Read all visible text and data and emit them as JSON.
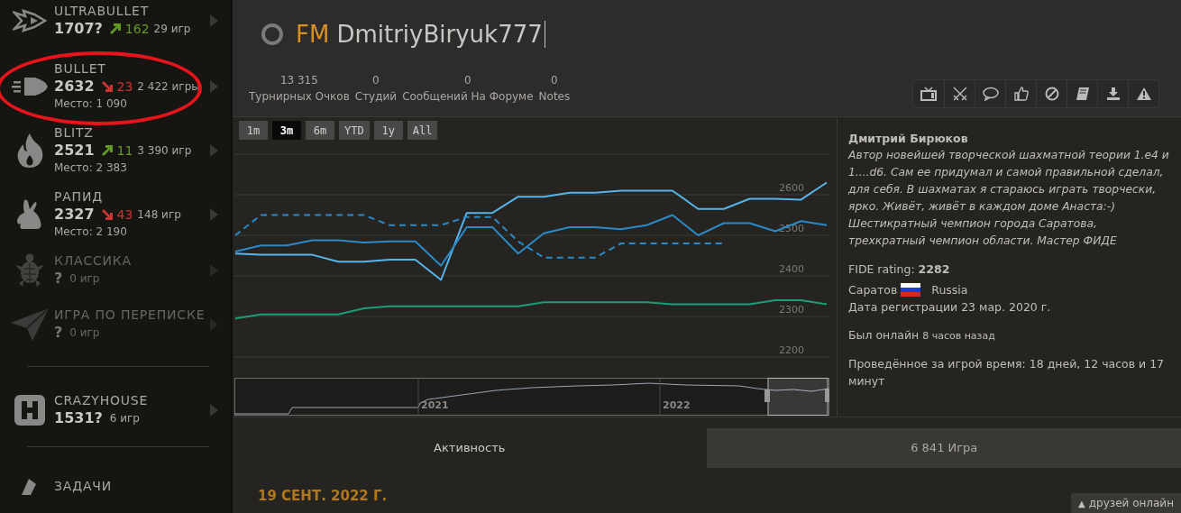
{
  "sidebar": {
    "items": [
      {
        "kind": "variant",
        "name": "ULTRABULLET",
        "rating": "1707?",
        "rising": true,
        "diff": "162",
        "games": "29 игр",
        "dim": false,
        "circled": false
      },
      {
        "kind": "variant",
        "name": "BULLET",
        "rating": "2632",
        "rising": false,
        "diff": "23",
        "games": "2 422 игры",
        "rank": "Место: 1 090",
        "dim": false,
        "circled": true
      },
      {
        "kind": "variant",
        "name": "BLITZ",
        "rating": "2521",
        "rising": true,
        "diff": "11",
        "games": "3 390 игр",
        "rank": "Место: 2 383",
        "dim": false,
        "circled": false
      },
      {
        "kind": "variant",
        "name": "РАПИД",
        "rating": "2327",
        "rising": false,
        "diff": "43",
        "games": "148 игр",
        "rank": "Место: 2 190",
        "dim": false,
        "circled": false
      },
      {
        "kind": "variant",
        "name": "КЛАССИКА",
        "rating": "?",
        "games": "0 игр",
        "dim": true,
        "circled": false
      },
      {
        "kind": "variant",
        "name": "ИГРА ПО ПЕРЕПИСКЕ",
        "rating": "?",
        "games": "0 игр",
        "dim": true,
        "circled": false
      },
      {
        "kind": "divider"
      },
      {
        "kind": "variant",
        "name": "CRAZYHOUSE",
        "rating": "1531?",
        "games": "6 игр",
        "dim": false,
        "circled": false
      },
      {
        "kind": "divider"
      },
      {
        "kind": "variant",
        "name": "ЗАДАЧИ",
        "dim": false,
        "circled": false
      }
    ]
  },
  "header": {
    "online": false,
    "title": "FM",
    "username": "DmitriyBiryuk777",
    "stats": [
      {
        "value": "13 315",
        "label": "Турнирных Очков"
      },
      {
        "value": "0",
        "label": "Студий"
      },
      {
        "value": "0",
        "label": "Сообщений На Форуме"
      },
      {
        "value": "0",
        "label": "Notes"
      }
    ]
  },
  "chart": {
    "ranges": [
      {
        "label": "1m",
        "selected": false
      },
      {
        "label": "3m",
        "selected": true
      },
      {
        "label": "6m",
        "selected": false
      },
      {
        "label": "YTD",
        "selected": false
      },
      {
        "label": "1y",
        "selected": false
      },
      {
        "label": "All",
        "selected": false
      }
    ],
    "chart_data": {
      "type": "line",
      "grid": true,
      "ylim": [
        2200,
        2700
      ],
      "yticks": [
        2200,
        2300,
        2400,
        2500,
        2600
      ],
      "series": [
        {
          "color": "#56b4e9",
          "line_style": "solid",
          "values": [
            2455,
            2452,
            2452,
            2452,
            2435,
            2435,
            2440,
            2440,
            2390,
            2555,
            2555,
            2595,
            2595,
            2605,
            2605,
            2610,
            2610,
            2610,
            2565,
            2565,
            2590,
            2590,
            2588,
            2630
          ]
        },
        {
          "color": "#2a8ac8",
          "line_style": "solid",
          "values": [
            2460,
            2475,
            2475,
            2488,
            2488,
            2482,
            2485,
            2485,
            2425,
            2520,
            2520,
            2455,
            2505,
            2520,
            2520,
            2515,
            2525,
            2550,
            2500,
            2530,
            2530,
            2510,
            2535,
            2525
          ]
        },
        {
          "color": "#2a8ac8",
          "line_style": "dashed",
          "values": [
            2500,
            2550,
            2550,
            2550,
            2550,
            2550,
            2525,
            2525,
            2525,
            2545,
            2545,
            2485,
            2445,
            2445,
            2445,
            2480,
            2480,
            2480,
            2480,
            2480,
            null,
            null,
            null,
            null
          ]
        },
        {
          "color": "#1b9e77",
          "line_style": "solid",
          "values": [
            2295,
            2305,
            2305,
            2305,
            2305,
            2320,
            2325,
            2325,
            2325,
            2325,
            2325,
            2325,
            2335,
            2335,
            2335,
            2335,
            2335,
            2330,
            2330,
            2330,
            2330,
            2340,
            2340,
            2330
          ]
        }
      ]
    },
    "navigator": {
      "labels": [
        "2021",
        "2022"
      ]
    }
  },
  "profile": {
    "real_name": "Дмитрий Бирюков",
    "bio": "Автор новейшей творческой шахматной теории 1.e4 и 1....d6. Сам ее придумал и самой правильной сделал, для себя. В шахматах я стараюсь играть творчески, ярко. Живёт, живёт в каждом доме Анаста:-) Шестикратный чемпион города Саратова, трехкратный чемпион области. Мастер ФИДЕ",
    "fide": "FIDE rating: **2282**",
    "city": "Саратов",
    "country": "Russia",
    "joined": "Дата регистрации 23 мар. 2020 г.",
    "seen_label": "Был онлайн",
    "seen_time": "8 часов назад",
    "playtime": "Проведённое за игрой время: 18 дней, 12 часов и 17 минут"
  },
  "tabs": [
    {
      "label": "Активность",
      "selected": true
    },
    {
      "label": "6 841 Игра",
      "selected": false
    }
  ],
  "activity": {
    "date": "19 СЕНТ. 2022 Г."
  },
  "friends_button": {
    "label": "друзей онлайн",
    "arrow": "▲"
  }
}
